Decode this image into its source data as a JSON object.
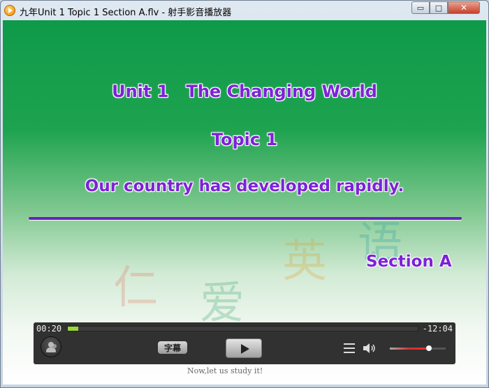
{
  "window": {
    "title": "九年Unit 1 Topic 1 Section A.flv - 射手影音播放器",
    "buttons": {
      "minimize": "▭",
      "maximize": "□",
      "close": "✕"
    }
  },
  "slide": {
    "title": "Unit 1   The Changing World",
    "topic": "Topic 1",
    "subtitle": "Our country has developed rapidly.",
    "section": "Section A",
    "watermark": [
      "仁",
      "爱",
      "英",
      "语"
    ],
    "caption": "Now,let us study it!"
  },
  "player": {
    "time_elapsed": "00:20",
    "time_remaining": "-12:04",
    "progress": 0.03,
    "subtitle_button": "字幕",
    "volume": 0.7
  },
  "icons": [
    "app-icon",
    "users-icon",
    "play-icon",
    "playlist-icon",
    "volume-icon"
  ],
  "colors": {
    "slide_text": "#7d22d8",
    "background_green": "#1ea34f",
    "seek_fill": "#9ad63a"
  }
}
